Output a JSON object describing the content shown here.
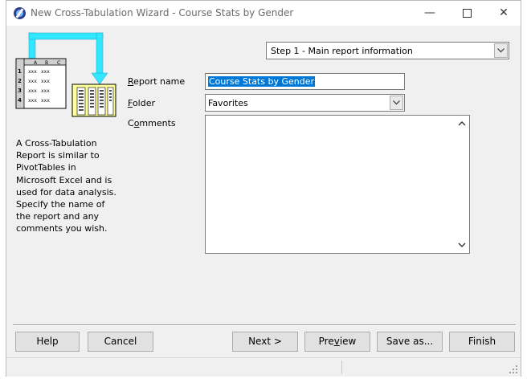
{
  "window": {
    "title": "New Cross-Tabulation Wizard - Course Stats by Gender",
    "minimize_glyph": "—",
    "close_glyph": "✕"
  },
  "step_selector": {
    "value": "Step 1 - Main report information"
  },
  "illustration": {
    "columns": [
      "A",
      "B",
      "C"
    ],
    "rows": [
      {
        "n": "1",
        "c1": "xxx",
        "c2": "xxx"
      },
      {
        "n": "2",
        "c1": "xxx",
        "c2": "xxx"
      },
      {
        "n": "3",
        "c1": "xxx",
        "c2": "xxx"
      },
      {
        "n": "4",
        "c1": "xxx",
        "c2": "xxx"
      }
    ],
    "arrow_color": "#33e6ff"
  },
  "description": "A Cross-Tabulation Report is similar to PivotTables in Microsoft Excel and is used for data analysis. Specify the name of the report and any comments you wish.",
  "form": {
    "report_name": {
      "label_u": "R",
      "label_rest": "eport name",
      "value": "Course Stats by Gender"
    },
    "folder": {
      "label_u": "F",
      "label_rest": "older",
      "value": "Favorites"
    },
    "comments": {
      "label_pre": "C",
      "label_u": "o",
      "label_rest": "mments",
      "value": ""
    }
  },
  "buttons": {
    "help": "Help",
    "cancel": "Cancel",
    "next": "Next >",
    "preview_pre": "Pre",
    "preview_u": "v",
    "preview_post": "iew",
    "save_as": "Save as...",
    "finish": "Finish"
  },
  "colors": {
    "selection": "#0078d7",
    "window_bg": "#f0f0f0"
  }
}
